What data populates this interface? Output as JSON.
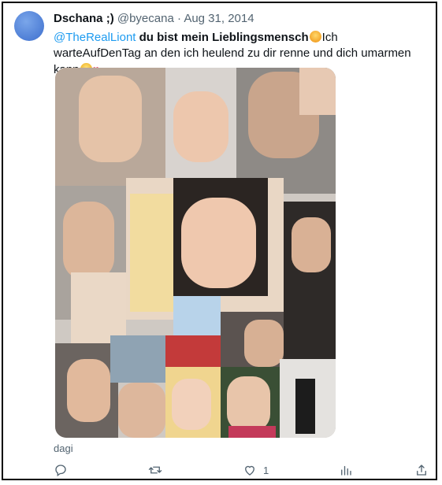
{
  "tweet": {
    "author_name": "Dschana ;)",
    "author_handle": "@byecana",
    "separator": "·",
    "date": "Aug 31, 2014",
    "mention": "@TheRealLiont",
    "bold_text": "du bist mein Lieblingsmensch",
    "text_rest": "Ich warteAufDenTag an den ich heulend zu dir renne und dich umarmen kann",
    "media_caption": "dagi",
    "like_count": "1"
  },
  "icons": {
    "reply": "reply-icon",
    "retweet": "retweet-icon",
    "like": "like-icon",
    "views": "views-icon",
    "share": "share-icon"
  },
  "colors": {
    "link": "#1d9bf0",
    "secondary_text": "#536471",
    "heart": "#e8385b"
  }
}
